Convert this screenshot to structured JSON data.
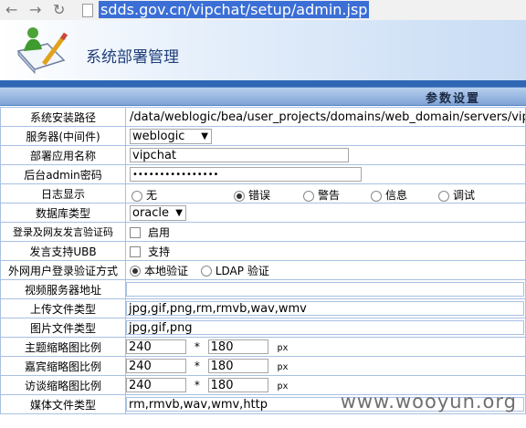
{
  "browser": {
    "url": "sdds.gov.cn/vipchat/setup/admin.jsp"
  },
  "banner": {
    "title": "系统部署管理"
  },
  "section": {
    "title": "参数设置"
  },
  "fields": {
    "install_path": {
      "label": "系统安装路径",
      "value": "/data/weblogic/bea/user_projects/domains/web_domain/servers/vipchat"
    },
    "server": {
      "label": "服务器(中间件)",
      "value": "weblogic"
    },
    "app_name": {
      "label": "部署应用名称",
      "value": "vipchat"
    },
    "admin_password": {
      "label": "后台admin密码",
      "value": "••••••••••••••••"
    },
    "log_display": {
      "label": "日志显示",
      "options": [
        "无",
        "错误",
        "警告",
        "信息",
        "调试"
      ],
      "selected": "错误"
    },
    "db_type": {
      "label": "数据库类型",
      "value": "oracle"
    },
    "captcha": {
      "label": "登录及网友发言验证码",
      "option": "启用"
    },
    "ubb": {
      "label": "发言支持UBB",
      "option": "支持"
    },
    "ext_login": {
      "label": "外网用户登录验证方式",
      "options": [
        "本地验证",
        "LDAP 验证"
      ],
      "selected": "本地验证"
    },
    "video_server": {
      "label": "视频服务器地址",
      "value": ""
    },
    "upload_types": {
      "label": "上传文件类型",
      "value": "jpg,gif,png,rm,rmvb,wav,wmv"
    },
    "image_types": {
      "label": "图片文件类型",
      "value": "jpg,gif,png"
    },
    "topic_thumb": {
      "label": "主题缩略图比例",
      "w": "240",
      "h": "180",
      "sep": "*",
      "unit": "px"
    },
    "guest_thumb": {
      "label": "嘉宾缩略图比例",
      "w": "240",
      "h": "180",
      "sep": "*",
      "unit": "px"
    },
    "interview_thumb": {
      "label": "访谈缩略图比例",
      "w": "240",
      "h": "180",
      "sep": "*",
      "unit": "px"
    },
    "media_types": {
      "label": "媒体文件类型",
      "value": "rm,rmvb,wav,wmv,http"
    }
  },
  "watermark": "www.wooyun.org"
}
